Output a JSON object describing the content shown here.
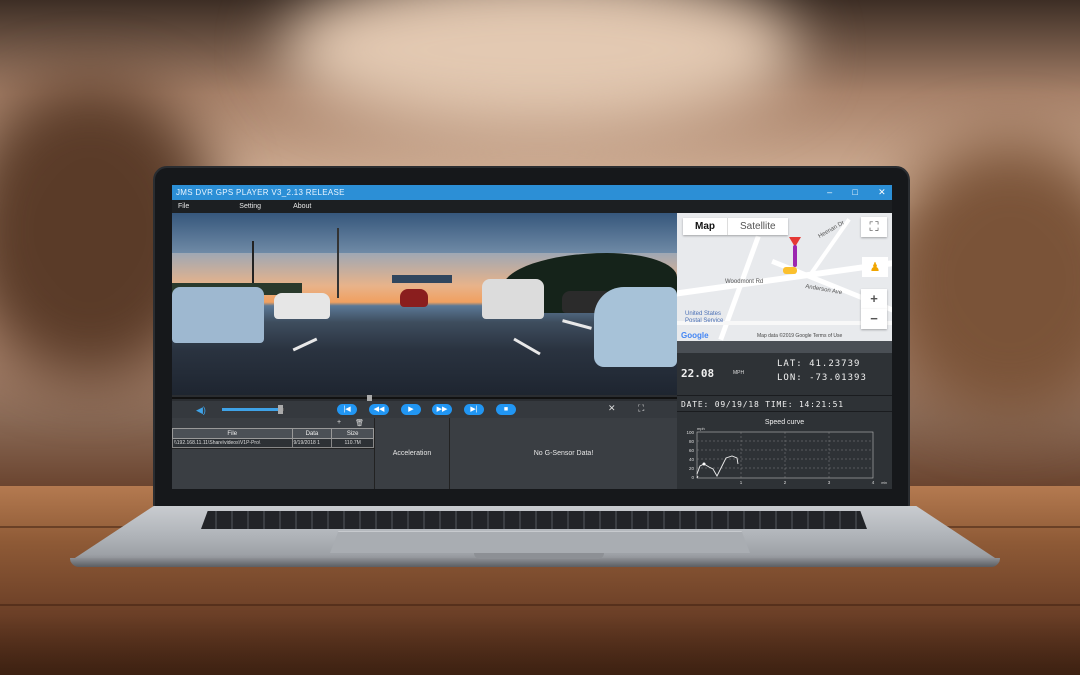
{
  "window": {
    "title": "JMS DVR GPS PLAYER V3_2.13 RELEASE",
    "minimize": "–",
    "maximize": "□",
    "close": "✕"
  },
  "menu": {
    "items": [
      "File",
      "Setting",
      "About"
    ]
  },
  "player": {
    "progress": 0.39,
    "volume": 0.9
  },
  "file_table": {
    "headers": [
      "File",
      "Data",
      "Size"
    ],
    "rows": [
      [
        "\\\\192.168.11.11\\Share\\videos\\V1P-Pro\\",
        "9/19/2018 1",
        "110.7M"
      ]
    ]
  },
  "panels": {
    "acceleration": "Acceleration",
    "gsensor": "No G-Sensor Data!"
  },
  "map": {
    "tab_map": "Map",
    "tab_satellite": "Satellite",
    "labels": {
      "woodmont": "Woodmont Rd",
      "anderson": "Anderson Ave",
      "postal_1": "United States",
      "postal_2": "Postal Service",
      "heenan": "Heenan Dr"
    },
    "google": "Google",
    "footer": "Map data ©2019 Google   Terms of Use",
    "zoom_in": "+",
    "zoom_out": "−"
  },
  "gps": {
    "speed": "22.08",
    "speed_unit": "MPH",
    "lat": "LAT:  41.23739",
    "lon": "LON:  -73.01393"
  },
  "datetime": {
    "text": "DATE:  09/19/18   TIME:  14:21:51"
  },
  "speed_curve": {
    "title": "Speed curve",
    "y_unit": "mph",
    "x_unit": "min",
    "y_ticks": [
      "100",
      "80",
      "60",
      "40",
      "20",
      "0"
    ],
    "x_ticks": [
      "1",
      "2",
      "3",
      "4"
    ]
  },
  "colors": {
    "accent": "#2196f3",
    "titlebar": "#2c8fd6",
    "route": "#9c27b0",
    "pin": "#e53935"
  }
}
